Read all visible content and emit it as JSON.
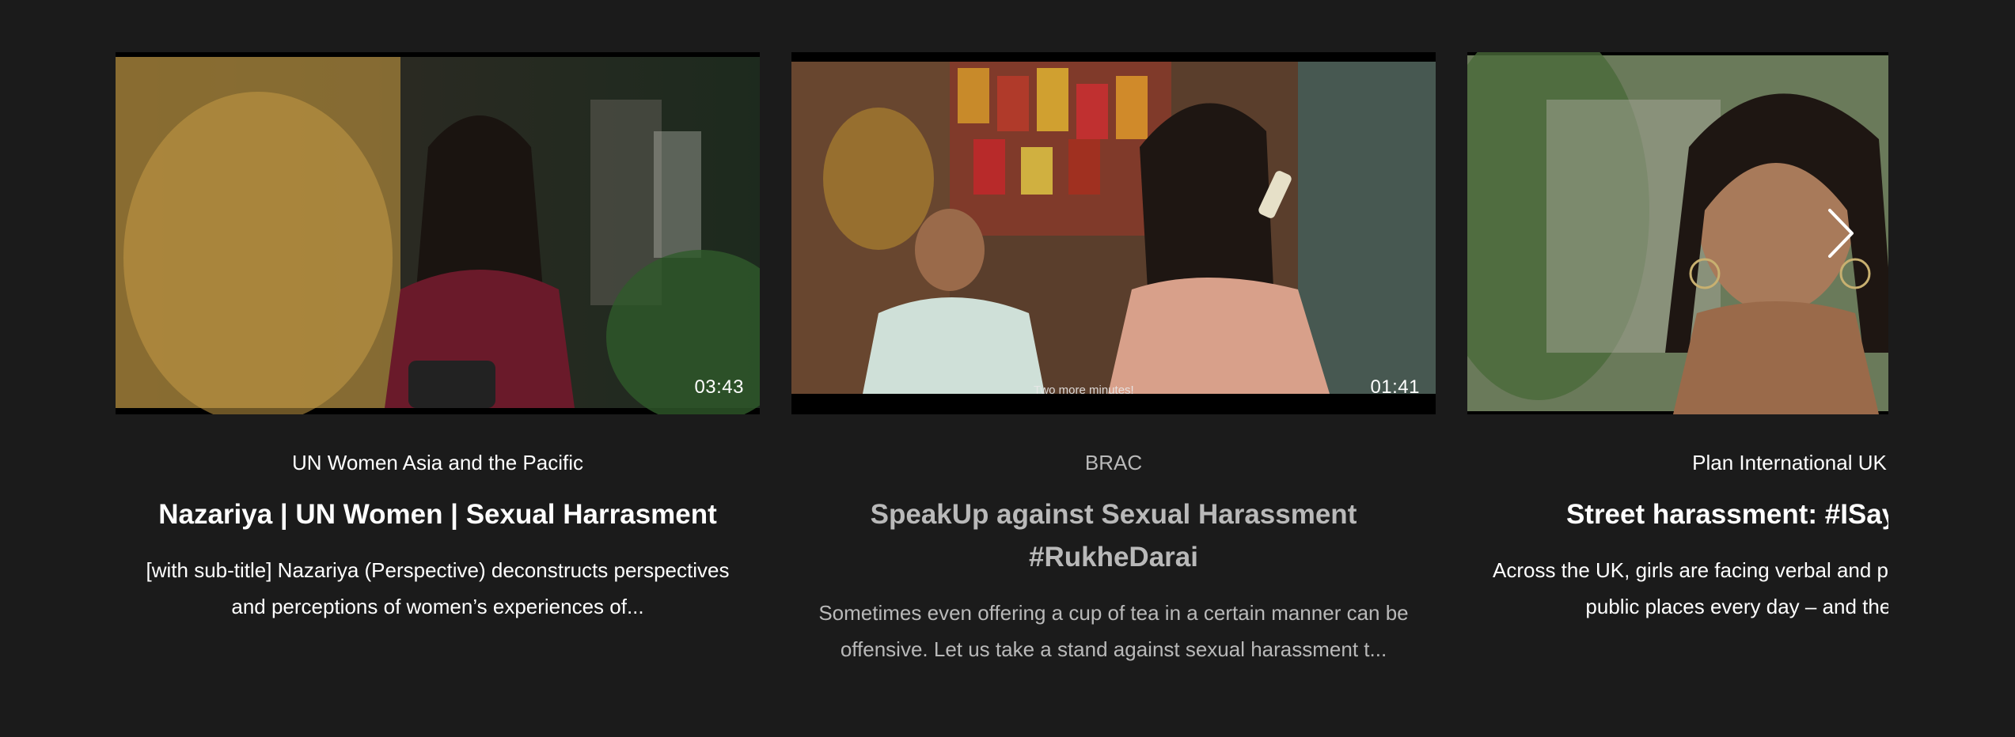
{
  "carousel": {
    "cards": [
      {
        "duration": "03:43",
        "channel": "UN Women Asia and the Pacific",
        "title": "Nazariya | UN Women | Sexual Harrasment",
        "description": "[with sub-title] Nazariya (Perspective) deconstructs perspectives and perceptions of women’s experiences of..."
      },
      {
        "duration": "01:41",
        "subtitle_caption": "Two more minutes!",
        "channel": "BRAC",
        "title": "SpeakUp against Sexual Harassment #RukheDarai",
        "description": "Sometimes even offering a cup of tea in a certain manner can be offensive. Let us take a stand against sexual harassment t..."
      },
      {
        "channel": "Plan International UK",
        "title": "Street harassment: #ISayItsNotOk",
        "description": "Across the UK, girls are facing verbal and physical harassment in public places every day – and they've told us"
      }
    ],
    "next_icon": "chevron-right-icon"
  }
}
